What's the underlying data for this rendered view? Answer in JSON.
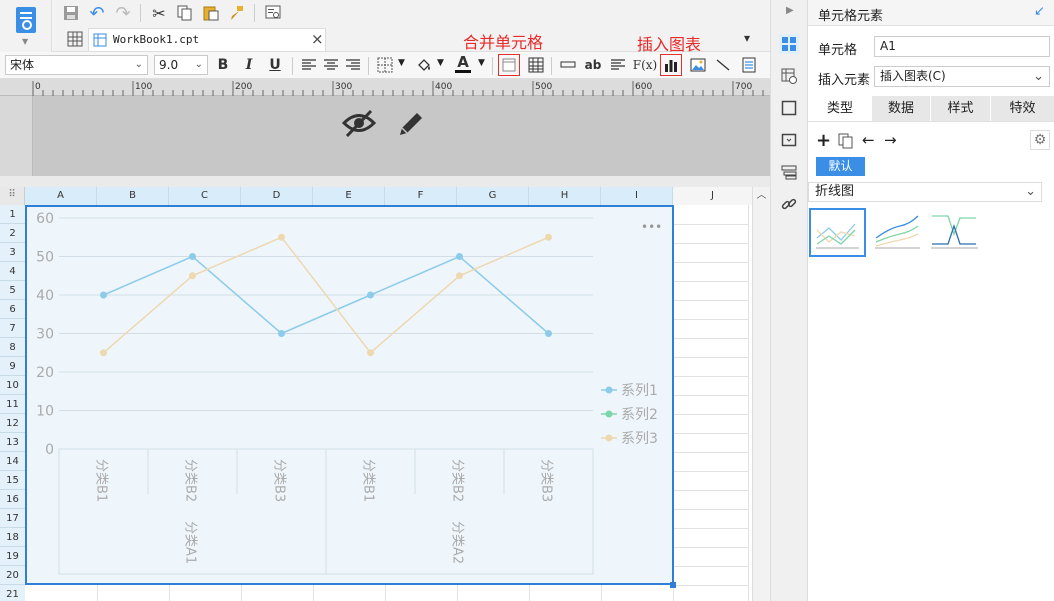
{
  "tab": {
    "file_name": "WorkBook1.cpt",
    "close": "×"
  },
  "font": {
    "name": "宋体",
    "size": "9.0"
  },
  "format_buttons": {
    "bold": "B",
    "italic": "I",
    "underline": "U",
    "color_letter": "A",
    "fx": "F(x)",
    "ab": "ab"
  },
  "annotations": {
    "merge": "合并单元格",
    "insert_chart": "插入图表"
  },
  "ruler": {
    "ticks": [
      "0",
      "100",
      "200",
      "300",
      "400",
      "500",
      "600",
      "700"
    ]
  },
  "columns": [
    "A",
    "B",
    "C",
    "D",
    "E",
    "F",
    "G",
    "H",
    "I",
    "J"
  ],
  "rows": [
    "1",
    "2",
    "3",
    "4",
    "5",
    "6",
    "7",
    "8",
    "9",
    "10",
    "11",
    "12",
    "13",
    "14",
    "15",
    "16",
    "17",
    "18",
    "19",
    "20",
    "21"
  ],
  "chart_data": {
    "type": "line",
    "categories": [
      "分类B1",
      "分类B2",
      "分类B3",
      "分类B1",
      "分类B2",
      "分类B3"
    ],
    "groups": [
      "分类A1",
      "分类A2"
    ],
    "series": [
      {
        "name": "系列1",
        "values": [
          40,
          50,
          30,
          40,
          50,
          30
        ],
        "color": "#8ccbea"
      },
      {
        "name": "系列2",
        "values": [
          null,
          null,
          null,
          null,
          null,
          null
        ],
        "color": "#7dd6a8"
      },
      {
        "name": "系列3",
        "values": [
          25,
          45,
          55,
          25,
          45,
          55
        ],
        "color": "#eed8b0"
      }
    ],
    "ylim": [
      0,
      60
    ],
    "yticks": [
      "60",
      "50",
      "40",
      "30",
      "20",
      "10",
      "0"
    ],
    "grid": true,
    "legend_position": "right",
    "more": "•••"
  },
  "right_panel": {
    "title": "单元格元素",
    "cell_label": "单元格",
    "cell_value": "A1",
    "insert_label": "插入元素",
    "insert_value": "插入图表(C)",
    "tabs": [
      "类型",
      "数据",
      "样式",
      "特效"
    ],
    "default_tag": "默认",
    "chart_type": "折线图"
  },
  "colors": {
    "accent": "#3a8ee6",
    "selection": "#2f7fd6",
    "annotation": "#e82a2a",
    "chart_bg": "#eef6fc"
  }
}
